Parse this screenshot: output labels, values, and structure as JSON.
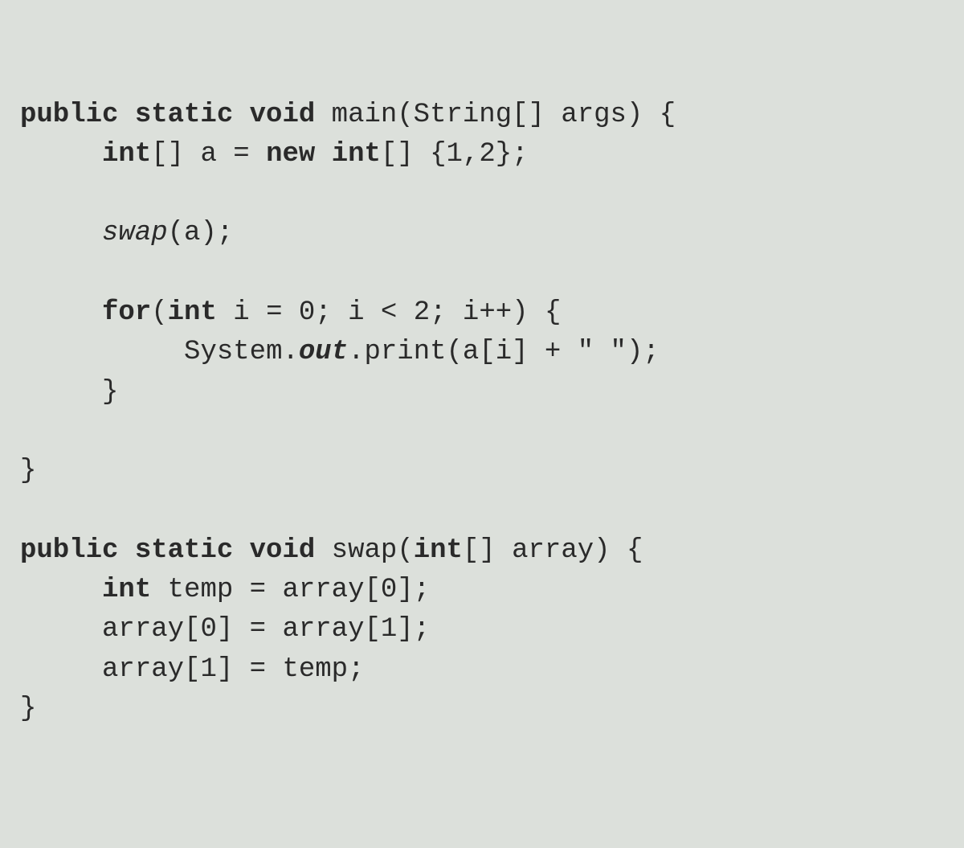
{
  "code": {
    "l1": {
      "kw1": "public static void",
      "rest": " main(String[] args) {"
    },
    "l2": {
      "indent": "     ",
      "kw": "int",
      "rest1": "[] a = ",
      "kw2": "new int",
      "rest2": "[] {1,2};"
    },
    "l3": "",
    "l4": {
      "indent": "     ",
      "call": "swap",
      "rest": "(a);"
    },
    "l5": "",
    "l6": {
      "indent": "     ",
      "kw": "for",
      "rest1": "(",
      "kw2": "int",
      "rest2": " i = 0; i < 2; i++) {"
    },
    "l7": {
      "indent": "          ",
      "pre": "System.",
      "field": "out",
      "rest": ".print(a[i] + \" \");"
    },
    "l8": {
      "indent": "     ",
      "brace": "}"
    },
    "l9": "",
    "l10": "}",
    "l11": "",
    "l12": {
      "kw1": "public static void",
      "rest1": " swap(",
      "kw2": "int",
      "rest2": "[] array) {"
    },
    "l13": {
      "indent": "     ",
      "kw": "int",
      "rest": " temp = array[0];"
    },
    "l14": {
      "indent": "     ",
      "rest": "array[0] = array[1];"
    },
    "l15": {
      "indent": "     ",
      "rest": "array[1] = temp;"
    },
    "l16": "}"
  }
}
